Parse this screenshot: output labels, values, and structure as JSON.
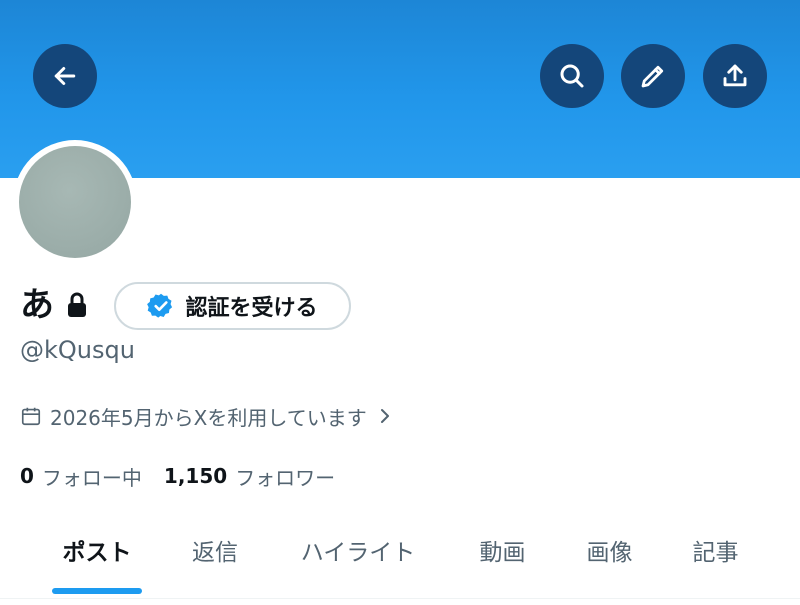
{
  "header": {
    "banner_color": "#2196ea",
    "back_icon": "arrow-left-icon",
    "search_icon": "search-icon",
    "edit_icon": "pencil-icon",
    "share_icon": "share-icon"
  },
  "profile": {
    "display_name": "あ",
    "lock_icon": "lock-icon",
    "verify_button_label": "認証を受ける",
    "verify_icon": "verified-badge-icon",
    "handle": "@kQusqu",
    "joined_text": "2026年5月からXを利用しています",
    "following_count": "0",
    "following_label": "フォロー中",
    "followers_count": "1,150",
    "followers_label": "フォロワー"
  },
  "tabs": [
    {
      "label": "ポスト",
      "active": true
    },
    {
      "label": "返信",
      "active": false
    },
    {
      "label": "ハイライト",
      "active": false
    },
    {
      "label": "動画",
      "active": false
    },
    {
      "label": "画像",
      "active": false
    },
    {
      "label": "記事",
      "active": false
    }
  ],
  "colors": {
    "accent": "#1d9bf0",
    "text_primary": "#0f1419",
    "text_secondary": "#536471"
  }
}
